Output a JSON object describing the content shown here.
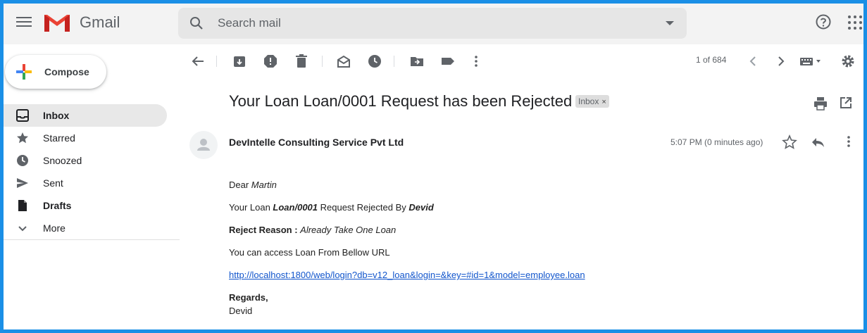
{
  "app": {
    "title": "Gmail"
  },
  "search": {
    "placeholder": "Search mail"
  },
  "compose": {
    "label": "Compose"
  },
  "sidebar": {
    "items": [
      {
        "label": "Inbox",
        "icon": "inbox-icon",
        "active": true,
        "bold": true
      },
      {
        "label": "Starred",
        "icon": "star-icon",
        "active": false,
        "bold": false
      },
      {
        "label": "Snoozed",
        "icon": "clock-icon",
        "active": false,
        "bold": false
      },
      {
        "label": "Sent",
        "icon": "send-icon",
        "active": false,
        "bold": false
      },
      {
        "label": "Drafts",
        "icon": "draft-icon",
        "active": false,
        "bold": true
      },
      {
        "label": "More",
        "icon": "chevron-down-icon",
        "active": false,
        "bold": false
      }
    ]
  },
  "toolbar": {
    "pager": "1 of 684",
    "icons": [
      "back-arrow-icon",
      "archive-icon",
      "report-spam-icon",
      "delete-icon",
      "mark-unread-icon",
      "snooze-icon",
      "move-to-icon",
      "label-icon",
      "more-vert-icon",
      "prev-icon",
      "next-icon",
      "keyboard-icon",
      "settings-icon"
    ]
  },
  "message": {
    "subject": "Your Loan Loan/0001 Request has been Rejected",
    "label_chip": "Inbox",
    "label_chip_close": "×",
    "sender": "DevIntelle Consulting Service Pvt Ltd",
    "time": "5:07 PM (0 minutes ago)",
    "body": {
      "greeting_prefix": "Dear ",
      "greeting_name": "Martin",
      "line1_a": "Your Loan ",
      "line1_loan": "Loan/0001",
      "line1_b": " Request Rejected By ",
      "line1_by": "Devid",
      "reason_label": "Reject Reason : ",
      "reason_text": "Already Take One Loan",
      "access_line": "You can access Loan From Bellow URL",
      "url": "http://localhost:1800/web/login?db=v12_loan&login=&key=#id=1&model=employee.loan",
      "regards": "Regards,",
      "signature": "Devid"
    }
  },
  "colors": {
    "frame_border": "#1a8fe6",
    "header_bg": "#f3f3f3",
    "link": "#1155cc",
    "gmail_red": "#ea4335"
  }
}
